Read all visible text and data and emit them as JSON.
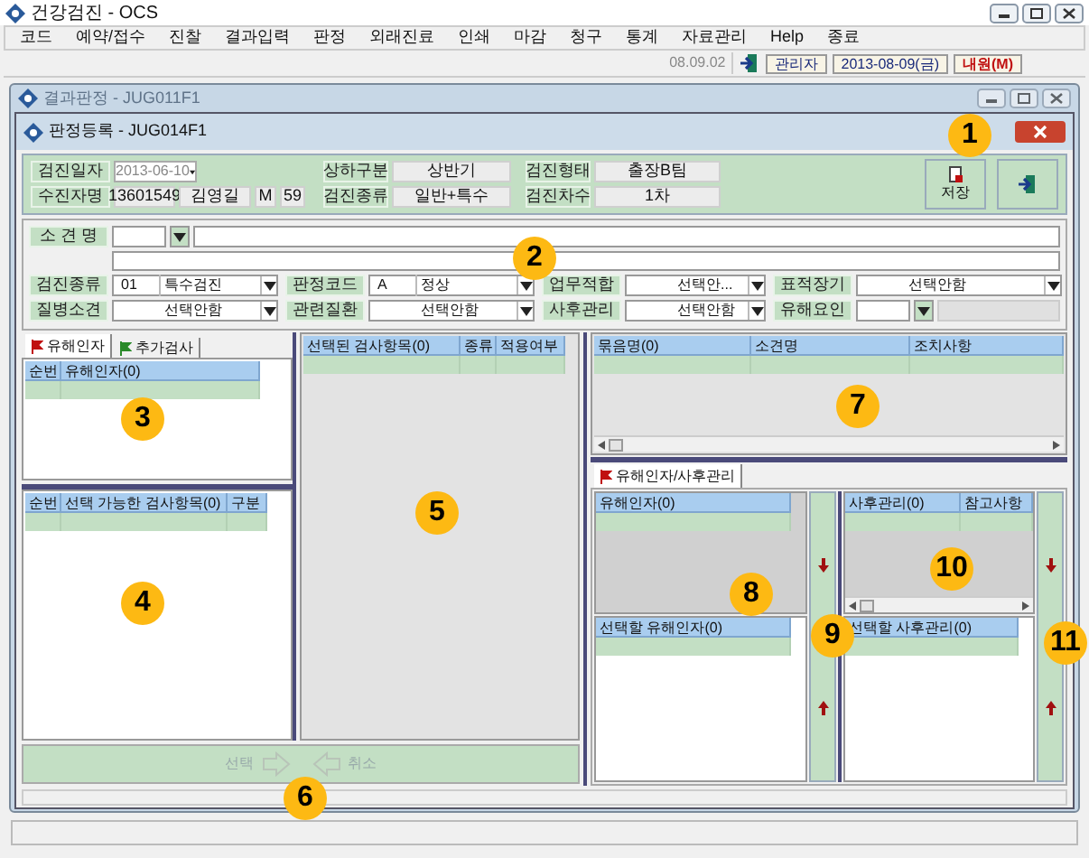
{
  "app": {
    "title": "건강검진 - OCS"
  },
  "menu": [
    "코드",
    "예약/접수",
    "진찰",
    "결과입력",
    "판정",
    "외래진료",
    "인쇄",
    "마감",
    "청구",
    "통계",
    "자료관리",
    "Help",
    "종료"
  ],
  "toolbar": {
    "version": "08.09.02",
    "user": "관리자",
    "date": "2013-08-09(금)",
    "visit": "내원(M)"
  },
  "background_window": {
    "title": "결과판정 - JUG011F1"
  },
  "window": {
    "title": "판정등록 - JUG014F1"
  },
  "header": {
    "exam_date_label": "검진일자",
    "exam_date": "2013-06-10",
    "patient_label": "수진자명",
    "patient_id": "13601549",
    "patient_name": "김영길",
    "sex": "M",
    "age": "59",
    "pairs": [
      {
        "label": "상하구분",
        "value": "상반기"
      },
      {
        "label": "검진형태",
        "value": "출장B팀"
      },
      {
        "label": "검진종류",
        "value": "일반+특수"
      },
      {
        "label": "검진차수",
        "value": "1차"
      }
    ]
  },
  "buttons": [
    {
      "kind": "save",
      "label": "저장"
    },
    {
      "kind": "exit"
    }
  ],
  "finding": {
    "label": "소 견 명"
  },
  "selects": [
    {
      "kind": "select",
      "label": "검진종류",
      "code": "01",
      "value": "특수검진"
    },
    {
      "kind": "select",
      "label": "판정코드",
      "code": "A",
      "value": "정상"
    },
    {
      "kind": "select",
      "label": "업무적합",
      "value": "선택안..."
    },
    {
      "kind": "select",
      "label": "표적장기",
      "value": "선택안함"
    },
    {
      "kind": "select",
      "label": "질병소견",
      "value": "선택안함"
    },
    {
      "kind": "select",
      "label": "관련질환",
      "value": "선택안함"
    },
    {
      "kind": "select",
      "label": "사후관리",
      "value": "선택안함"
    },
    {
      "kind": "combo",
      "label": "유해요인"
    }
  ],
  "left_tabs": [
    {
      "label": "유해인자",
      "selected": true
    },
    {
      "label": "추가검사",
      "selected": false
    }
  ],
  "factor_grid": {
    "columns": [
      "순번",
      "유해인자(0)"
    ]
  },
  "available_grid": {
    "columns": [
      "순번",
      "선택 가능한 검사항목(0)",
      "구분"
    ]
  },
  "selected_grid": {
    "columns": [
      "선택된 검사항목(0)",
      "종류",
      "적용여부"
    ]
  },
  "move_bar": {
    "select": "선택",
    "cancel": "취소",
    "disabled": true
  },
  "finding_grid": {
    "columns": [
      "묶음명(0)",
      "소견명",
      "조치사항"
    ]
  },
  "right_tab": {
    "label": "유해인자/사후관리",
    "selected": true
  },
  "factor_list": {
    "columns": [
      "유해인자(0)"
    ],
    "pick_columns": [
      "선택할 유해인자(0)"
    ]
  },
  "care_list": {
    "columns": [
      "사후관리(0)",
      "참고사항"
    ],
    "pick_columns": [
      "선택할 사후관리(0)"
    ]
  },
  "callouts": [
    "1",
    "2",
    "3",
    "4",
    "5",
    "6",
    "7",
    "8",
    "9",
    "10",
    "11"
  ]
}
